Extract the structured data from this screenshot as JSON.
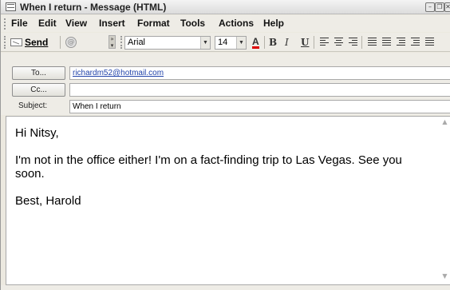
{
  "window": {
    "title": "When I return - Message (HTML)",
    "controls": [
      "minimize",
      "restore",
      "close"
    ]
  },
  "menu": {
    "items": [
      "File",
      "Edit",
      "View",
      "Insert",
      "Format",
      "Tools",
      "Actions",
      "Help"
    ]
  },
  "toolbar": {
    "send_label": "Send",
    "font_name": "Arial",
    "font_size": "14",
    "icons": [
      "help-icon",
      "font-color-icon",
      "bold-icon",
      "italic-icon",
      "underline-icon",
      "align-left-icon",
      "align-center-icon",
      "align-right-icon",
      "bullets-icon",
      "numbering-icon",
      "decrease-indent-icon",
      "increase-indent-icon",
      "line-icon"
    ]
  },
  "header": {
    "to_label": "To...",
    "to_value": "richardm52@hotmail.com",
    "cc_label": "Cc...",
    "cc_value": "",
    "subject_label": "Subject:",
    "subject_value": "When I return"
  },
  "body": {
    "greeting": "Hi Nitsy,",
    "paragraph": "I'm not in the office either! I'm on a fact-finding trip to Las Vegas. See you soon.",
    "signoff": "Best, Harold"
  }
}
